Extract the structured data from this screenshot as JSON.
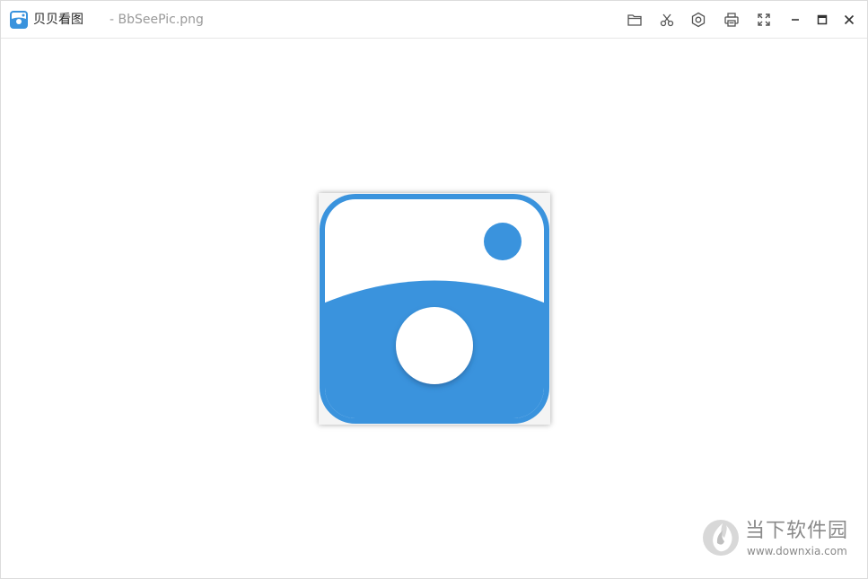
{
  "window": {
    "app_title": "贝贝看图",
    "file_name": "- BbSeePic.png"
  },
  "toolbar": {
    "icons": [
      "folder-icon",
      "scissors-icon",
      "settings-icon",
      "print-icon",
      "fullscreen-icon",
      "minimize-icon",
      "maximize-icon",
      "close-icon"
    ]
  },
  "watermark": {
    "brand": "当下软件园",
    "url": "www.downxia.com"
  },
  "colors": {
    "accent": "#3a93dd",
    "title_text": "#222222",
    "file_text": "#9a9a9a",
    "watermark": "#8a8a8a"
  }
}
